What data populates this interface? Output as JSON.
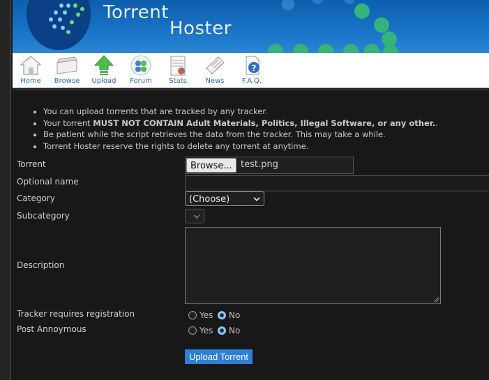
{
  "brand": {
    "line1": "Torrent",
    "line2": "Hoster"
  },
  "nav": [
    {
      "label": "Home",
      "icon": "house-icon"
    },
    {
      "label": "Browse",
      "icon": "tray-icon"
    },
    {
      "label": "Upload",
      "icon": "up-arrow-icon"
    },
    {
      "label": "Forum",
      "icon": "people-icon"
    },
    {
      "label": "Stats",
      "icon": "chart-icon"
    },
    {
      "label": "News",
      "icon": "newspaper-icon"
    },
    {
      "label": "F.A.Q.",
      "icon": "question-icon"
    }
  ],
  "notes": {
    "n1": "You can upload torrents that are tracked by any tracker.",
    "n2_pre": "Your torrent ",
    "n2_bold": "MUST NOT CONTAIN Adult Materials, Politics, Illegal Software, or any other.",
    "n2_post": ".",
    "n3": "Be patient while the script retrieves the data from the tracker. This may take a while.",
    "n4": "Torrent Hoster reserve the rights to delete any torrent at anytime."
  },
  "form": {
    "torrent_label": "Torrent",
    "browse_label": "Browse...",
    "file_name": "test.png",
    "optional_name_label": "Optional name",
    "optional_name_value": "",
    "category_label": "Category",
    "category_value": "(Choose)",
    "subcategory_label": "Subcategory",
    "description_label": "Description",
    "tracker_reg_label": "Tracker requires registration",
    "tracker_reg_value": "No",
    "post_anon_label": "Post Annoymous",
    "post_anon_value": "No",
    "yes_label": "Yes",
    "no_label": "No",
    "submit_label": "Upload Torrent"
  },
  "colors": {
    "banner": "#1a73c6",
    "link": "#2a6fb8",
    "submit": "#2f7fd6",
    "dot_green": "#39b54a"
  }
}
